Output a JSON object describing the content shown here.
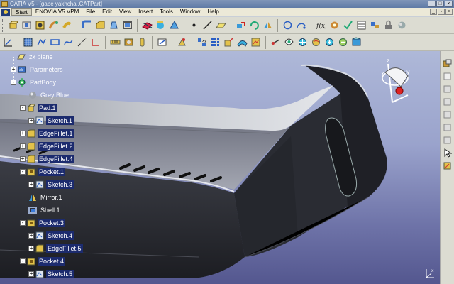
{
  "window": {
    "title": "CATIA V5 - [gabe yakhchal.CATPart]"
  },
  "menu": [
    "Start",
    "ENOVIA V5 VPM",
    "File",
    "Edit",
    "View",
    "Insert",
    "Tools",
    "Window",
    "Help"
  ],
  "tree": [
    {
      "label": "zx plane",
      "icon": "plane-icon",
      "expander": ""
    },
    {
      "label": "Parameters",
      "icon": "parameters-icon",
      "expander": "+"
    },
    {
      "label": "PartBody",
      "icon": "partbody-gear-icon",
      "expander": "-"
    },
    {
      "label": "Grey Blue",
      "icon": "material-sphere-icon",
      "expander": ""
    },
    {
      "label": "Pad.1",
      "icon": "pad-icon",
      "expander": "-"
    },
    {
      "label": "Sketch.1",
      "icon": "sketch-icon",
      "expander": "+"
    },
    {
      "label": "EdgeFillet.1",
      "icon": "edge-fillet-icon",
      "expander": "+"
    },
    {
      "label": "EdgeFillet.2",
      "icon": "edge-fillet-icon",
      "expander": "+"
    },
    {
      "label": "EdgeFillet.4",
      "icon": "edge-fillet-icon",
      "expander": "+"
    },
    {
      "label": "Pocket.1",
      "icon": "pocket-icon",
      "expander": "-"
    },
    {
      "label": "Sketch.3",
      "icon": "sketch-icon",
      "expander": "+"
    },
    {
      "label": "Mirror.1",
      "icon": "mirror-icon",
      "expander": ""
    },
    {
      "label": "Shell.1",
      "icon": "shell-icon",
      "expander": ""
    },
    {
      "label": "Pocket.3",
      "icon": "pocket-icon",
      "expander": "-"
    },
    {
      "label": "Sketch.4",
      "icon": "sketch-icon",
      "expander": "+"
    },
    {
      "label": "EdgeFillet.5",
      "icon": "edge-fillet-icon",
      "expander": "+"
    },
    {
      "label": "Pocket.4",
      "icon": "pocket-icon",
      "expander": "-"
    },
    {
      "label": "Sketch.5",
      "icon": "sketch-icon",
      "expander": "+"
    }
  ],
  "colors": {
    "selection": "#1c2b6e",
    "viewport_top": "#aeb8d8",
    "viewport_bottom": "#54578f",
    "model": "#2a2c33"
  }
}
